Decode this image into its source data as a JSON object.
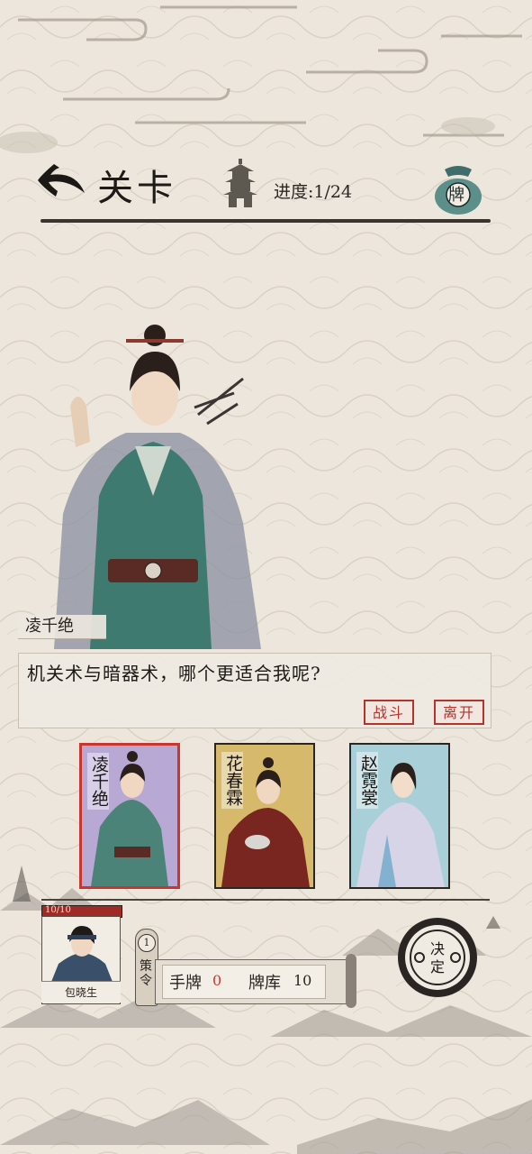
{
  "header": {
    "title": "关卡",
    "progress_label": "进度:",
    "progress_value": "1/24",
    "card_bag_label": "牌"
  },
  "encounter": {
    "speaker": "凌千绝",
    "dialog": "机关术与暗器术，哪个更适合我呢?",
    "fight_label": "战斗",
    "leave_label": "离开"
  },
  "cards": [
    {
      "name": "凌千绝",
      "bg": "#b7a8d4",
      "selected": true
    },
    {
      "name": "花春霖",
      "bg": "#d6b96a",
      "selected": false
    },
    {
      "name": "赵霓裳",
      "bg": "#a9cfd9",
      "selected": false
    }
  ],
  "hero": {
    "name": "包晓生",
    "hp_text": "10/10",
    "hp_current": 10,
    "hp_max": 10
  },
  "strategy": {
    "count": "1",
    "label": "策令"
  },
  "resources": {
    "hand_label": "手牌",
    "hand_value": "0",
    "deck_label": "牌库",
    "deck_value": "10"
  },
  "decide_label": "决定",
  "colors": {
    "accent_red": "#c8362e",
    "ink": "#2a2420",
    "paper": "#ece6dc"
  }
}
